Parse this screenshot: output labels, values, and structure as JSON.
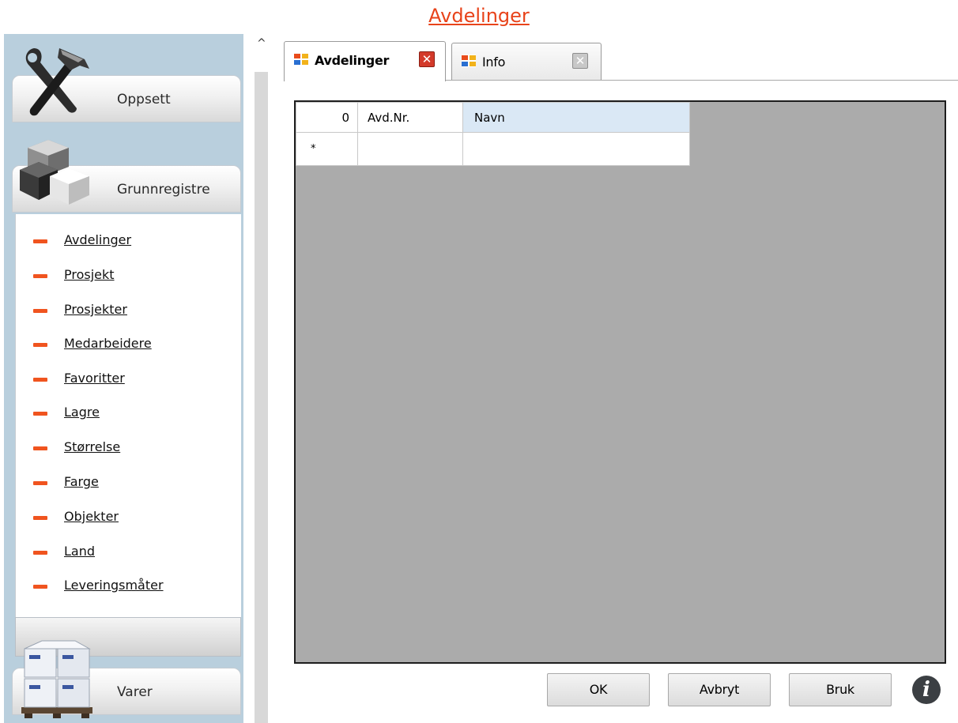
{
  "page": {
    "title": "Avdelinger"
  },
  "sidebar": {
    "header_oppsett": "Oppsett",
    "header_grunnregistre": "Grunnregistre",
    "header_varer": "Varer",
    "items": [
      {
        "label": "Avdelinger"
      },
      {
        "label": "Prosjekt"
      },
      {
        "label": "Prosjekter"
      },
      {
        "label": "Medarbeidere"
      },
      {
        "label": "Favoritter"
      },
      {
        "label": "Lagre"
      },
      {
        "label": "Størrelse"
      },
      {
        "label": "Farge"
      },
      {
        "label": "Objekter"
      },
      {
        "label": "Land"
      },
      {
        "label": "Leveringsmåter"
      }
    ],
    "item_icon": "orange-dash-icon"
  },
  "splitter": {
    "collapse_glyph": "^"
  },
  "tabs": [
    {
      "label": "Avdelinger",
      "active": true,
      "icon": "form-icon",
      "close_icon": "close-icon"
    },
    {
      "label": "Info",
      "active": false,
      "icon": "form-icon",
      "close_icon": "close-icon"
    }
  ],
  "grid": {
    "row_header": "0",
    "columns": [
      "Avd.Nr.",
      "Navn"
    ],
    "new_row_marker": "*",
    "rows": []
  },
  "buttons": {
    "ok": "OK",
    "cancel": "Avbryt",
    "apply": "Bruk",
    "info": "i"
  },
  "colors": {
    "sidebar_bg": "#b9cfdd",
    "accent_orange": "#f0541f",
    "grid_bg": "#ababab",
    "selected_header": "#dae8f5",
    "tab_close_active": "#d33a2a"
  }
}
